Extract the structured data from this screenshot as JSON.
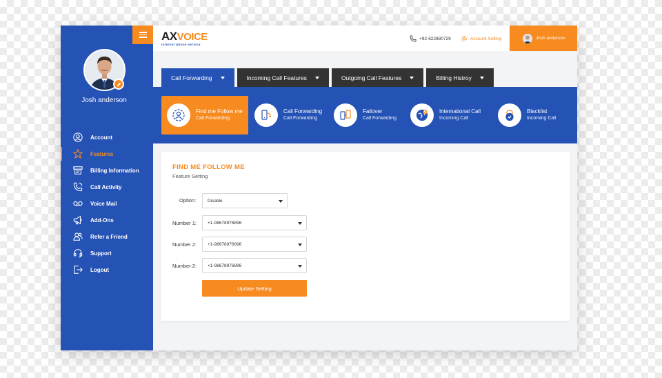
{
  "sidebar": {
    "user_name": "Josh anderson",
    "items": [
      {
        "label": "Account",
        "icon": "user-icon"
      },
      {
        "label": "Features",
        "icon": "star-icon"
      },
      {
        "label": "Billing Information",
        "icon": "billing-icon"
      },
      {
        "label": "Call Activity",
        "icon": "phone-icon"
      },
      {
        "label": "Voice Mail",
        "icon": "voicemail-icon"
      },
      {
        "label": "Add-Ons",
        "icon": "megaphone-icon"
      },
      {
        "label": "Refer a Friend",
        "icon": "users-icon"
      },
      {
        "label": "Support",
        "icon": "headset-icon"
      },
      {
        "label": "Logout",
        "icon": "logout-icon"
      }
    ],
    "active_item": "Features"
  },
  "header": {
    "logo_ax": "AX",
    "logo_voice": "VOICE",
    "logo_tagline": "internet phone service",
    "phone": "+92-622880729",
    "account_setting": "Account Setting",
    "user_name": "Josh anderson"
  },
  "tabs": [
    {
      "label": "Call Forwarding",
      "active": true
    },
    {
      "label": "Incoming Call Features",
      "active": false
    },
    {
      "label": "Outgoing Call Features",
      "active": false
    },
    {
      "label": "Billing Histroy",
      "active": false
    }
  ],
  "features": [
    {
      "title": "Find me Follow me",
      "subtitle": "Call Forwarding",
      "icon": "find-me-icon",
      "active": true
    },
    {
      "title": "Call Forwarding",
      "subtitle": "Call Forwarding",
      "icon": "call-forwarding-icon",
      "active": false
    },
    {
      "title": "Failover",
      "subtitle": "Call Forwarding",
      "icon": "failover-icon",
      "active": false
    },
    {
      "title": "International Call",
      "subtitle": "Incoming Call",
      "icon": "globe-icon",
      "active": false
    },
    {
      "title": "Blacklist",
      "subtitle": "Incoming Call",
      "icon": "lock-icon",
      "active": false
    }
  ],
  "form": {
    "title": "FIND ME FOLLOW ME",
    "subtitle": "Feature Setting",
    "option_label": "Option:",
    "option_value": "Disable",
    "numbers": [
      {
        "label": "Number 1:",
        "value": "+1-98678976896"
      },
      {
        "label": "Number 2:",
        "value": "+1-98678976896"
      },
      {
        "label": "Number 2:",
        "value": "+1-98678976896"
      }
    ],
    "submit_label": "Update Setting"
  },
  "colors": {
    "primary": "#2553b5",
    "accent": "#f78b20",
    "dark_tab": "#333333"
  }
}
